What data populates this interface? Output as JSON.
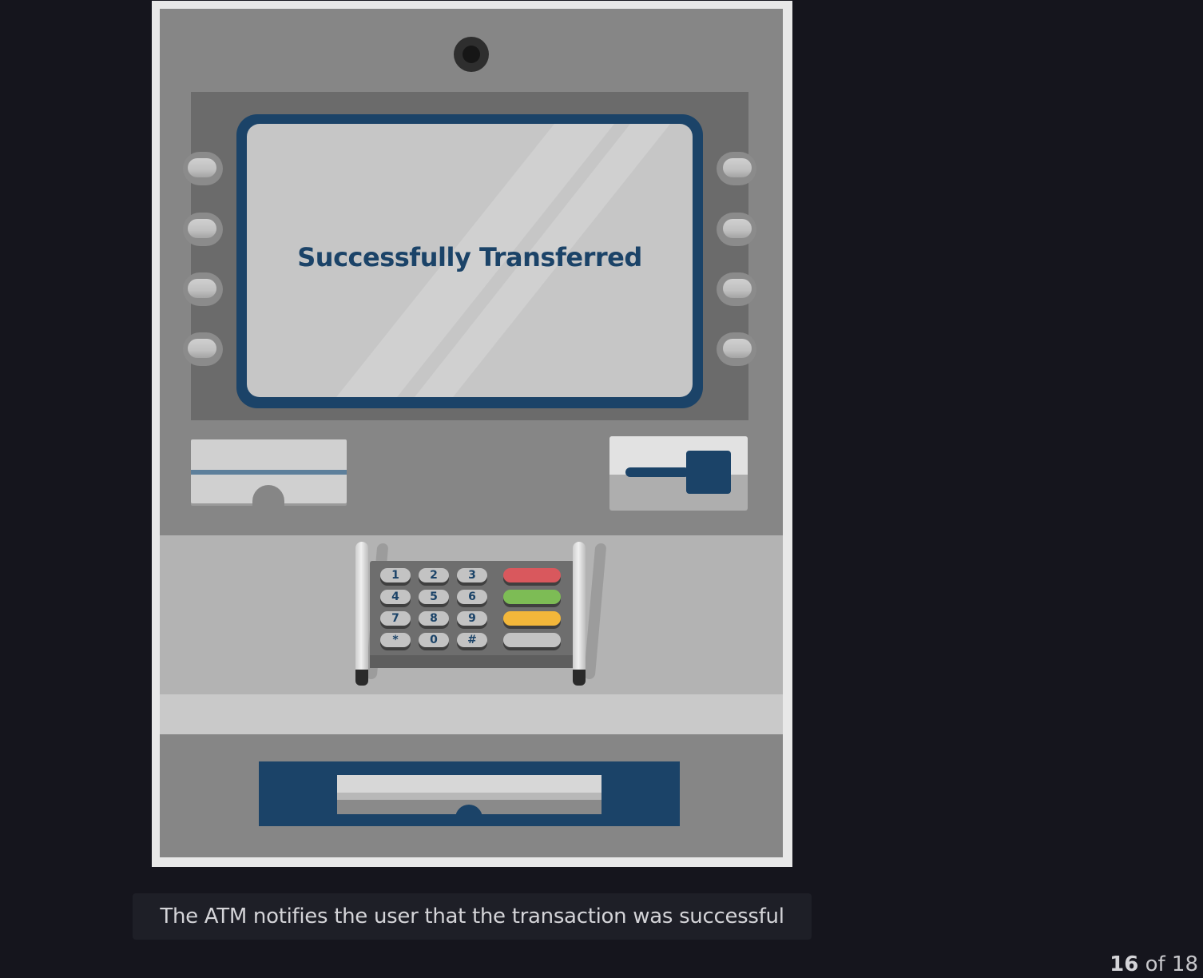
{
  "screen": {
    "message": "Successfully Transferred"
  },
  "keypad": {
    "keys": [
      "1",
      "2",
      "3",
      "4",
      "5",
      "6",
      "7",
      "8",
      "9",
      "*",
      "0",
      "#"
    ],
    "function_keys": [
      {
        "name": "cancel",
        "color": "#d9585d"
      },
      {
        "name": "enter",
        "color": "#7dbc55"
      },
      {
        "name": "clear",
        "color": "#f3b73a"
      },
      {
        "name": "blank",
        "color": "#c3c3c3"
      }
    ]
  },
  "caption": "The ATM notifies the user that the transaction was successful",
  "pager": {
    "current": "16",
    "separator": "of",
    "total": "18"
  },
  "colors": {
    "accent": "#1b4368",
    "background": "#15151d"
  }
}
